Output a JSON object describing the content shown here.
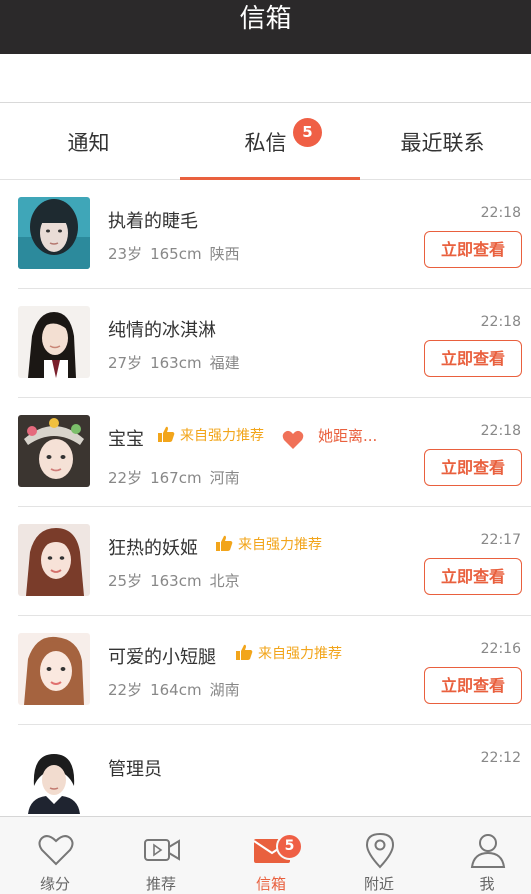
{
  "header": {
    "title": "信箱"
  },
  "tabs": [
    {
      "label": "通知"
    },
    {
      "label": "私信",
      "badge": "5"
    },
    {
      "label": "最近联系"
    }
  ],
  "messages": [
    {
      "name": "执着的睫毛",
      "age": "23岁",
      "height": "165cm",
      "location": "陕西",
      "time": "22:18",
      "button": "立即查看"
    },
    {
      "name": "纯情的冰淇淋",
      "age": "27岁",
      "height": "163cm",
      "location": "福建",
      "time": "22:18",
      "button": "立即查看"
    },
    {
      "name": "宝宝",
      "recommend": "来自强力推荐",
      "distance": "她距离...",
      "age": "22岁",
      "height": "167cm",
      "location": "河南",
      "time": "22:18",
      "button": "立即查看"
    },
    {
      "name": "狂热的妖姬",
      "recommend": "来自强力推荐",
      "age": "25岁",
      "height": "163cm",
      "location": "北京",
      "time": "22:17",
      "button": "立即查看"
    },
    {
      "name": "可爱的小短腿",
      "recommend": "来自强力推荐",
      "age": "22岁",
      "height": "164cm",
      "location": "湖南",
      "time": "22:16",
      "button": "立即查看"
    },
    {
      "name": "管理员",
      "time": "22:12"
    }
  ],
  "bottom_nav": [
    {
      "label": "缘分",
      "icon": "heart-icon"
    },
    {
      "label": "推荐",
      "icon": "video-icon"
    },
    {
      "label": "信箱",
      "icon": "mail-icon",
      "badge": "5",
      "active": true
    },
    {
      "label": "附近",
      "icon": "location-pin-icon"
    },
    {
      "label": "我",
      "icon": "person-icon"
    }
  ],
  "colors": {
    "accent": "#e9603e",
    "badge": "#ef5f45",
    "recommend": "#f2a51b",
    "titlebar": "#2b292a"
  }
}
